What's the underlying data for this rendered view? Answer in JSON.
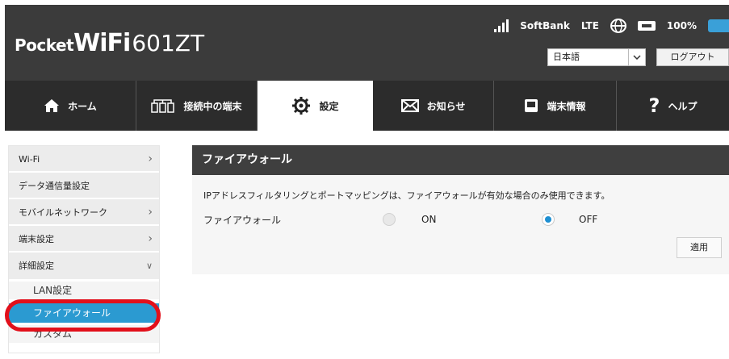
{
  "header": {
    "logo_pocket": "Pocket",
    "logo_wifi": "WiFi",
    "logo_model": "601ZT",
    "carrier": "SoftBank",
    "network": "LTE",
    "battery": "100%",
    "language": "日本語",
    "logout_label": "ログアウト"
  },
  "nav": {
    "items": [
      {
        "label": "ホーム",
        "icon": "home-icon"
      },
      {
        "label": "接続中の端末",
        "icon": "devices-icon"
      },
      {
        "label": "設定",
        "icon": "gear-icon",
        "active": true
      },
      {
        "label": "お知らせ",
        "icon": "mail-icon"
      },
      {
        "label": "端末情報",
        "icon": "device-info-icon"
      },
      {
        "label": "ヘルプ",
        "icon": "question-icon"
      }
    ]
  },
  "sidebar": {
    "items": [
      {
        "label": "Wi-Fi"
      },
      {
        "label": "データ通信量設定"
      },
      {
        "label": "モバイルネットワーク"
      },
      {
        "label": "端末設定"
      },
      {
        "label": "詳細設定"
      }
    ],
    "subitems": [
      {
        "label": "LAN設定"
      },
      {
        "label": "ファイアウォール",
        "active": true
      },
      {
        "label": "カスタム"
      }
    ]
  },
  "main": {
    "title": "ファイアウォール",
    "description": "IPアドレスフィルタリングとポートマッピングは、ファイアウォールが有効な場合のみ使用できます。",
    "firewall_label": "ファイアウォール",
    "option_on": "ON",
    "option_off": "OFF",
    "selected": "OFF",
    "apply_label": "適用"
  },
  "colors": {
    "header_bg": "#3b3b3b",
    "nav_bg": "#2c2c2c",
    "accent": "#2b9ad1",
    "highlight": "#e2101b"
  }
}
